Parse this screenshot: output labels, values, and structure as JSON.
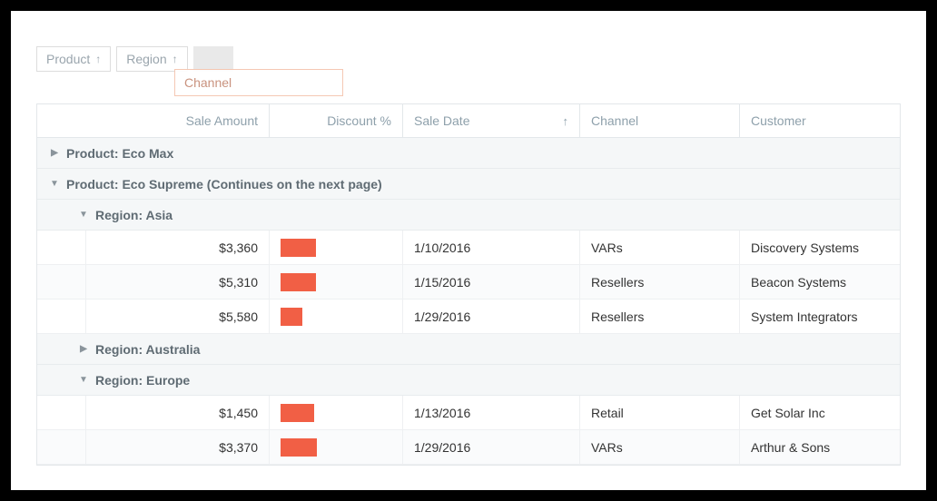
{
  "groupPanel": {
    "chip0": "Product",
    "chip1": "Region",
    "dragLabel": "Channel"
  },
  "headers": {
    "amount": "Sale Amount",
    "discount": "Discount %",
    "date": "Sale Date",
    "channel": "Channel",
    "customer": "Customer"
  },
  "groups": {
    "g0": "Product: Eco Max",
    "g1": "Product: Eco Supreme (Continues on the next page)",
    "g1_r0": "Region: Asia",
    "g1_r1": "Region: Australia",
    "g1_r2": "Region: Europe"
  },
  "rows": {
    "asia": {
      "r0": {
        "amount": "$3,360",
        "discPct": 32,
        "date": "1/10/2016",
        "channel": "VARs",
        "customer": "Discovery Systems"
      },
      "r1": {
        "amount": "$5,310",
        "discPct": 32,
        "date": "1/15/2016",
        "channel": "Resellers",
        "customer": "Beacon Systems"
      },
      "r2": {
        "amount": "$5,580",
        "discPct": 20,
        "date": "1/29/2016",
        "channel": "Resellers",
        "customer": "System Integrators"
      }
    },
    "europe": {
      "r0": {
        "amount": "$1,450",
        "discPct": 30,
        "date": "1/13/2016",
        "channel": "Retail",
        "customer": "Get Solar Inc"
      },
      "r1": {
        "amount": "$3,370",
        "discPct": 33,
        "date": "1/29/2016",
        "channel": "VARs",
        "customer": "Arthur & Sons"
      }
    }
  }
}
